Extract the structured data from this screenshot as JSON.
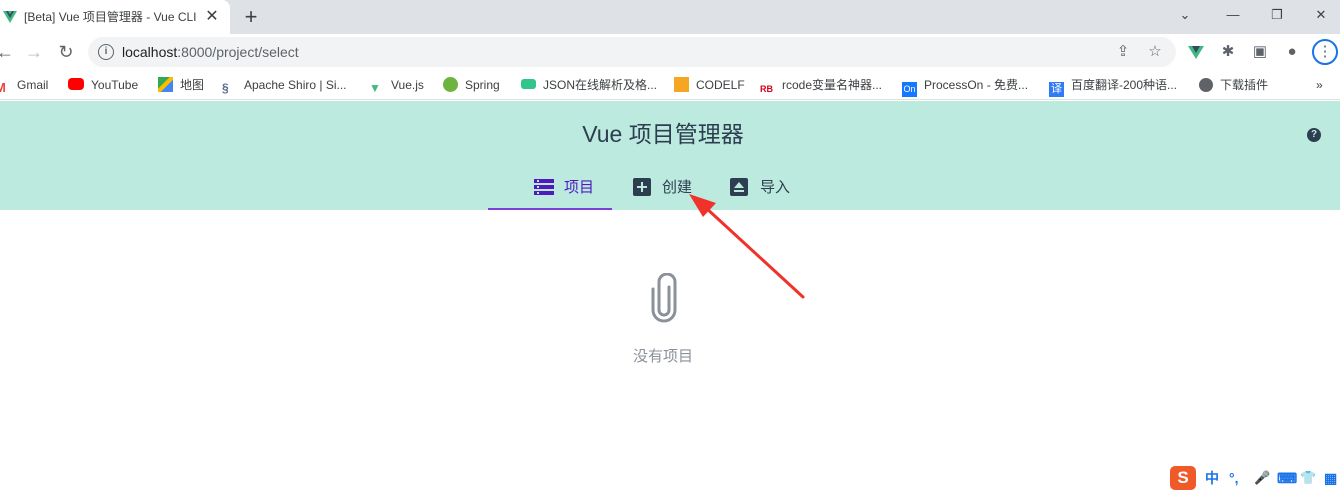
{
  "browser": {
    "tab": {
      "title": "[Beta] Vue 项目管理器 - Vue CLI",
      "close_icon": "close-icon"
    },
    "new_tab_label": "+",
    "window_controls": {
      "minimize": "⌄",
      "restore": "—",
      "maximize": "❐",
      "close": "✕"
    },
    "url": {
      "host": "localhost",
      "path": ":8000/project/select"
    },
    "bookmarks": [
      {
        "label": "Gmail",
        "icon": "gmail-icon",
        "color": "#ea4335"
      },
      {
        "label": "YouTube",
        "icon": "youtube-icon",
        "color": "#ff0000"
      },
      {
        "label": "地图",
        "icon": "maps-icon",
        "color": "#34a853"
      },
      {
        "label": "Apache Shiro | Si...",
        "icon": "shiro-icon",
        "color": "#5a6b8c"
      },
      {
        "label": "Vue.js",
        "icon": "vue-icon",
        "color": "#41b883"
      },
      {
        "label": "Spring",
        "icon": "spring-icon",
        "color": "#6db33f"
      },
      {
        "label": "JSON在线解析及格...",
        "icon": "json-icon",
        "color": "#31c48d"
      },
      {
        "label": "CODELF",
        "icon": "codelf-icon",
        "color": "#f5a623"
      },
      {
        "label": "rcode变量名神器...",
        "icon": "rb-icon",
        "color": "#d0021b"
      },
      {
        "label": "ProcessOn - 免费...",
        "icon": "processon-icon",
        "color": "#1677ff"
      },
      {
        "label": "百度翻译-200种语...",
        "icon": "translate-icon",
        "color": "#2f7cf6"
      },
      {
        "label": "下载插件",
        "icon": "globe-icon",
        "color": "#5f6368"
      }
    ],
    "overflow_label": "»"
  },
  "app": {
    "title": "Vue 项目管理器",
    "help_label": "?",
    "tabs": [
      {
        "label": "项目",
        "active": true
      },
      {
        "label": "创建",
        "active": false
      },
      {
        "label": "导入",
        "active": false
      }
    ],
    "empty_text": "没有项目"
  },
  "colors": {
    "header_bg": "#bdeadf",
    "active_tab": "#7e3fd6",
    "arrow": "#f0322a"
  },
  "ime": {
    "logo": "S",
    "items": [
      "中",
      "°,",
      "🎤",
      "⌨",
      "👕",
      "▦"
    ]
  }
}
